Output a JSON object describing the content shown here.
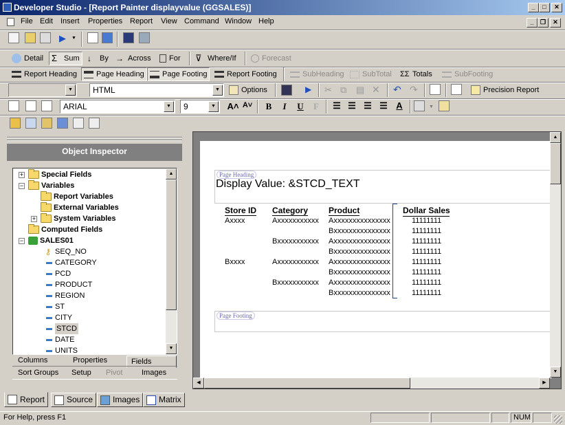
{
  "window": {
    "title": "Developer Studio - [Report Painter displayvalue (GGSALES)]"
  },
  "menu": [
    "File",
    "Edit",
    "Insert",
    "Properties",
    "Report",
    "View",
    "Command",
    "Window",
    "Help"
  ],
  "toolbar_row2": {
    "detail": "Detail",
    "sum": "Sum",
    "by": "By",
    "across": "Across",
    "for": "For",
    "where_if": "Where/If",
    "forecast": "Forecast"
  },
  "toolbar_row3": {
    "report_heading": "Report Heading",
    "page_heading": "Page Heading",
    "page_footing": "Page Footing",
    "report_footing": "Report Footing",
    "subheading": "SubHeading",
    "subtotal": "SubTotal",
    "totals": "Totals",
    "subfooting": "SubFooting"
  },
  "toolbar_row4": {
    "format": "HTML",
    "options": "Options",
    "precision_report": "Precision Report"
  },
  "toolbar_row5": {
    "font": "ARIAL",
    "size": "9"
  },
  "inspector": {
    "title": "Object Inspector",
    "tree": {
      "special_fields": "Special Fields",
      "variables": "Variables",
      "report_variables": "Report Variables",
      "external_variables": "External Variables",
      "system_variables": "System Variables",
      "computed_fields": "Computed Fields",
      "sales01": "SALES01",
      "fields": [
        "SEQ_NO",
        "CATEGORY",
        "PCD",
        "PRODUCT",
        "REGION",
        "ST",
        "CITY",
        "STCD",
        "DATE",
        "UNITS"
      ]
    },
    "tabs": {
      "columns": "Columns",
      "properties": "Properties",
      "fields": "Fields",
      "sort_groups": "Sort Groups",
      "setup": "Setup",
      "pivot": "Pivot",
      "images": "Images"
    }
  },
  "report": {
    "page_heading_label": "Page Heading",
    "heading_text": "Display Value: &STCD_TEXT",
    "columns": [
      "Store ID",
      "Category",
      "Product",
      "Dollar Sales"
    ],
    "rows": [
      [
        "Axxxx",
        "Axxxxxxxxxxx",
        "Axxxxxxxxxxxxxxx",
        "11111111"
      ],
      [
        "",
        "",
        "Bxxxxxxxxxxxxxxx",
        "11111111"
      ],
      [
        "",
        "Bxxxxxxxxxxx",
        "Axxxxxxxxxxxxxxx",
        "11111111"
      ],
      [
        "",
        "",
        "Bxxxxxxxxxxxxxxx",
        "11111111"
      ],
      [
        "Bxxxx",
        "Axxxxxxxxxxx",
        "Axxxxxxxxxxxxxxx",
        "11111111"
      ],
      [
        "",
        "",
        "Bxxxxxxxxxxxxxxx",
        "11111111"
      ],
      [
        "",
        "Bxxxxxxxxxxx",
        "Axxxxxxxxxxxxxxx",
        "11111111"
      ],
      [
        "",
        "",
        "Bxxxxxxxxxxxxxxx",
        "11111111"
      ]
    ],
    "page_footing_label": "Page Footing"
  },
  "bottom_tabs": {
    "report": "Report",
    "source": "Source",
    "images": "Images",
    "matrix": "Matrix"
  },
  "status": {
    "help": "For Help, press F1",
    "num": "NUM"
  }
}
